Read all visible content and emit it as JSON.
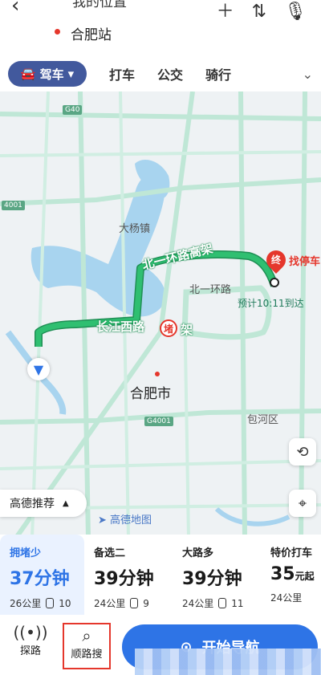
{
  "header": {
    "origin": "我的位置",
    "destination": "合肥站"
  },
  "modes": {
    "drive": "驾车",
    "taxi": "打车",
    "bus": "公交",
    "bike": "骑行"
  },
  "map": {
    "labels": {
      "town": "大杨镇",
      "ring_elevated": "北一环路高架",
      "ring": "北一环路",
      "changjiang": "长江西路",
      "elevated_suffix": "架",
      "congestion_mark": "堵",
      "city": "合肥市",
      "district": "包河区"
    },
    "road_tags": {
      "g40": "G40",
      "g4001_left": "4001",
      "g4001": "G4001"
    },
    "end_pin": "终",
    "parking": "找停车",
    "eta": "预计10:11到达",
    "recommend": "高德推荐",
    "logo": "高德地图"
  },
  "routes": [
    {
      "tag": "拥堵少",
      "minutes": "37",
      "unit": "分钟",
      "distance": "26公里",
      "lights": "10",
      "active": true
    },
    {
      "tag": "备选二",
      "minutes": "39",
      "unit": "分钟",
      "distance": "24公里",
      "lights": "9",
      "active": false
    },
    {
      "tag": "大路多",
      "minutes": "39",
      "unit": "分钟",
      "distance": "24公里",
      "lights": "11",
      "active": false
    },
    {
      "tag": "特价打车",
      "minutes": "35",
      "unit": "元起",
      "distance": "24公里",
      "lights": "",
      "active": false
    }
  ],
  "bottom": {
    "explore": "探路",
    "search_along": "顺路搜",
    "start_nav": "开始导航"
  },
  "colors": {
    "accent": "#2e74e6",
    "route_green": "#2fbf71",
    "drive_pill": "#42599d",
    "alert_red": "#e5372c"
  }
}
